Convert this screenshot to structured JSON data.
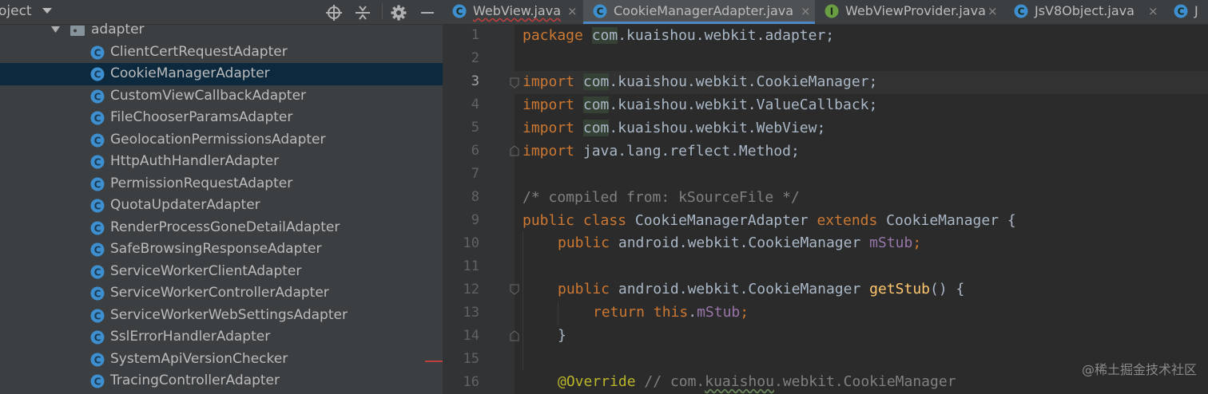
{
  "project_panel": {
    "title": "oject",
    "folder": "adapter",
    "selected_item": "CookieManagerAdapter",
    "items": [
      "ClientCertRequestAdapter",
      "CookieManagerAdapter",
      "CustomViewCallbackAdapter",
      "FileChooserParamsAdapter",
      "GeolocationPermissionsAdapter",
      "HttpAuthHandlerAdapter",
      "PermissionRequestAdapter",
      "QuotaUpdaterAdapter",
      "RenderProcessGoneDetailAdapter",
      "SafeBrowsingResponseAdapter",
      "ServiceWorkerClientAdapter",
      "ServiceWorkerControllerAdapter",
      "ServiceWorkerWebSettingsAdapter",
      "SslErrorHandlerAdapter",
      "SystemApiVersionChecker",
      "TracingControllerAdapter"
    ]
  },
  "tabs": [
    {
      "label": "WebView.java",
      "icon": "class-icon",
      "active": false
    },
    {
      "label": "CookieManagerAdapter.java",
      "icon": "class-icon",
      "active": true
    },
    {
      "label": "WebViewProvider.java",
      "icon": "interface-icon",
      "active": false
    },
    {
      "label": "JsV8Object.java",
      "icon": "class-icon",
      "active": false
    },
    {
      "label": "J",
      "icon": "class-icon",
      "active": false
    }
  ],
  "tab_close_glyph": "×",
  "editor": {
    "current_line": 3,
    "line_numbers": [
      "1",
      "2",
      "3",
      "4",
      "5",
      "6",
      "7",
      "8",
      "9",
      "10",
      "11",
      "12",
      "13",
      "14",
      "15",
      "16"
    ],
    "code": {
      "l1": {
        "kw": "package",
        "pkg": "com",
        "rest": ".kuaishou.webkit.adapter;"
      },
      "l3": {
        "kw": "import",
        "pkg": "com",
        "rest": ".kuaishou.webkit.CookieManager;"
      },
      "l4": {
        "kw": "import",
        "pkg": "com",
        "rest": ".kuaishou.webkit.ValueCallback;"
      },
      "l5": {
        "kw": "import",
        "pkg": "com",
        "rest": ".kuaishou.webkit.WebView;"
      },
      "l6": {
        "kw": "import",
        "rest": " java.lang.reflect.Method;"
      },
      "l8": {
        "comment": "/* compiled from: kSourceFile */"
      },
      "l9": {
        "kw1": "public class",
        "name": " CookieManagerAdapter ",
        "kw2": "extends",
        "rest": " CookieManager {"
      },
      "l10": {
        "kw": "public",
        "type": " android.webkit.CookieManager ",
        "field": "mStub",
        "end": ";"
      },
      "l12": {
        "kw": "public",
        "type": " android.webkit.CookieManager ",
        "fn": "getStub",
        "end": "() {"
      },
      "l13": {
        "kw": "return this",
        "dot": ".",
        "field": "mStub",
        "end": ";"
      },
      "l14": {
        "text": "}"
      },
      "l16": {
        "ann": "@Override",
        "c1": " // com.",
        "c2": "kuaishou",
        "c3": ".webkit.CookieManager"
      }
    }
  },
  "watermark": "@稀土掘金技术社区",
  "colors": {
    "keyword": "#cc7832",
    "text": "#a9b7c6",
    "field": "#9876aa",
    "function": "#ffc66d",
    "comment": "#808080",
    "annotation": "#bbb529",
    "selection": "#0d293e",
    "class_icon": "#3d8fcf",
    "interface_icon": "#6a9e43"
  }
}
